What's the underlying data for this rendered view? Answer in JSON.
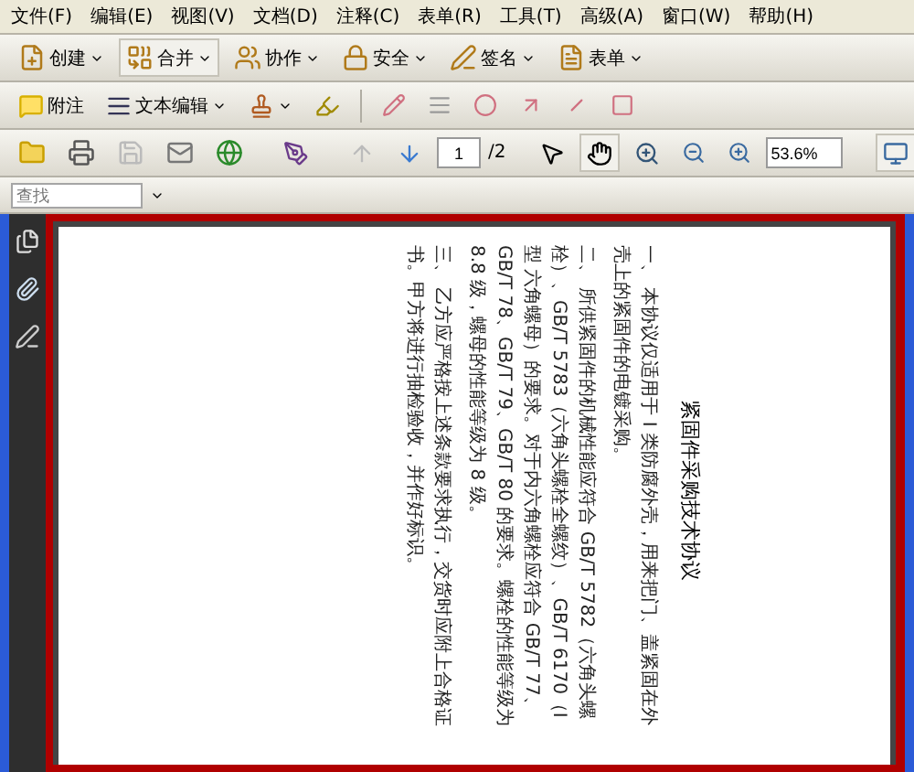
{
  "menu": [
    "文件(F)",
    "编辑(E)",
    "视图(V)",
    "文档(D)",
    "注释(C)",
    "表单(R)",
    "工具(T)",
    "高级(A)",
    "窗口(W)",
    "帮助(H)"
  ],
  "toolbar_tasks": [
    "创建",
    "合并",
    "协作",
    "安全",
    "签名",
    "表单"
  ],
  "toolbar_comment": {
    "note": "附注",
    "text_edit": "文本编辑"
  },
  "navigation": {
    "page": "1",
    "page_total": "/2",
    "zoom": "53.6%"
  },
  "search": {
    "placeholder": "查找"
  },
  "document": {
    "title": "紧固件采购技术协议",
    "paragraphs": [
      "一、 本协议仅适用于 I 类防腐外壳，用来把门、盖紧固在外壳上的紧固件的电镀采购。",
      "二、 所供紧固件的机械性能应符合 GB/T 5782（六角头螺栓）、GB/T 5783（六角头螺栓全螺纹）、GB/T 6170（I 型 六角螺母）的要求。对于内六角螺栓应符合 GB/T 77、GB/T 78、GB/T 79、GB/T 80 的要求。螺栓的性能等级为 8.8 级，螺母的性能等级为 8 级。",
      "三、 乙方应严格按上述条款要求执行，交货时应附上合格证书。甲方将进行抽检验收，并作好标识。"
    ]
  }
}
